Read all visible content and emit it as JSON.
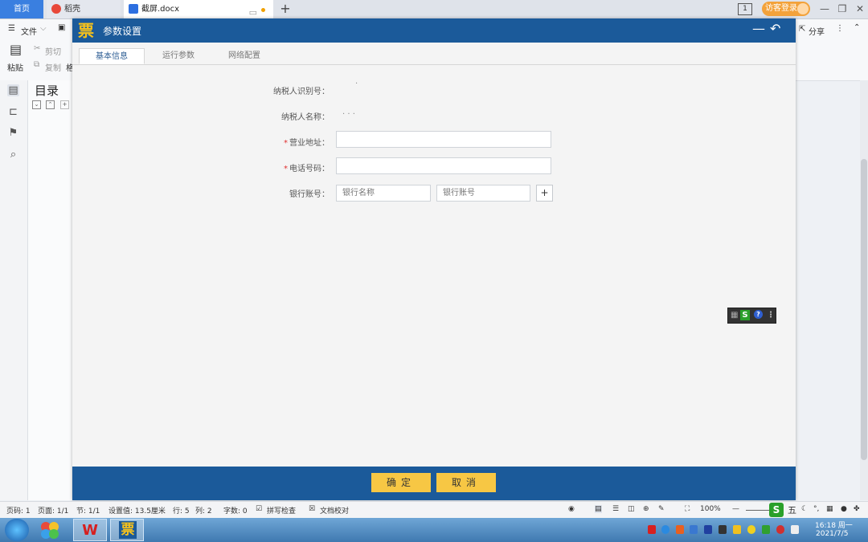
{
  "tabbar": {
    "home": "首页",
    "daoke": "稻壳",
    "doc": "截屏.docx",
    "add": "+",
    "window_number": "1",
    "visitor_login": "访客登录"
  },
  "toolbar": {
    "file_menu": "文件",
    "cut": "剪切",
    "copy": "复制",
    "paste": "粘贴",
    "format_brush_partial": "格",
    "share": "分享"
  },
  "toc": {
    "title": "目录"
  },
  "dialog": {
    "title": "参数设置",
    "logo_char": "票",
    "tabs": [
      "基本信息",
      "运行参数",
      "网络配置"
    ],
    "fields": {
      "taxpayer_id_label": "纳税人识别号：",
      "taxpayer_id_value": "·",
      "taxpayer_name_label": "纳税人名称：",
      "taxpayer_name_value": "·  ·  ·",
      "business_address_label": "营业地址：",
      "phone_label": "电话号码：",
      "bank_account_label": "银行账号：",
      "bank_name_placeholder": "银行名称",
      "bank_account_placeholder": "银行账号",
      "required_mark": "*",
      "add_label": "+"
    },
    "ok": "确定",
    "cancel": "取消"
  },
  "statusbar": {
    "page_code": "页码: 1",
    "pages": "页面: 1/1",
    "section": "节: 1/1",
    "setting_value": "设置值: 13.5厘米",
    "row": "行: 5",
    "col": "列: 2",
    "word_count": "字数: 0",
    "spell_check": "拼写检查",
    "doc_proof": "文档校对",
    "zoom": "100%",
    "ime_char": "五"
  },
  "taskbar": {
    "wps": "W",
    "piao": "票",
    "time": "16:18 周一",
    "date": "2021/7/5"
  },
  "colors": {
    "dialog_header": "#1b5a9a",
    "button_yellow": "#f7c744",
    "required_red": "#e03030",
    "tab_active_blue": "#3a7fe0"
  }
}
